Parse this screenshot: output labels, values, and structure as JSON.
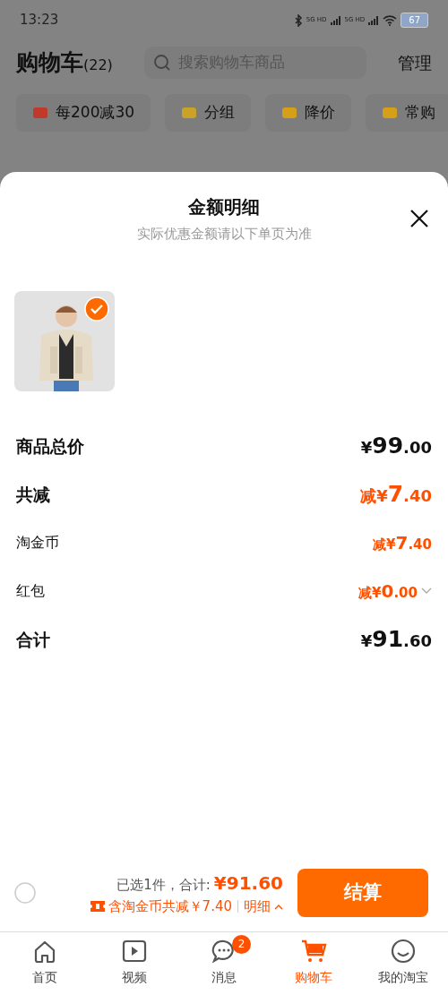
{
  "status_bar": {
    "time": "13:23",
    "network_1": "5G HD",
    "network_2": "5G HD",
    "battery": "67"
  },
  "header": {
    "title": "购物车",
    "count": "(22)",
    "search": {
      "placeholder": "搜索购物车商品"
    },
    "manage": "管理"
  },
  "chips": [
    {
      "label": "每200减30",
      "color": "#c0392b"
    },
    {
      "label": "分组",
      "color": "#c9a227"
    },
    {
      "label": "降价",
      "color": "#d4a017"
    },
    {
      "label": "常购",
      "color": "#d4a017"
    }
  ],
  "sheet": {
    "title": "金额明细",
    "subtitle": "实际优惠金额请以下单页为准",
    "item": {
      "kind": "picture",
      "selected": true
    },
    "rows": [
      {
        "kind": "main",
        "label": "商品总价",
        "prefix": "¥",
        "integer": "99",
        "decimal": ".00",
        "highlight": false,
        "expandable": false
      },
      {
        "kind": "main",
        "label": "共减",
        "prefix": "减¥",
        "integer": "7",
        "decimal": ".40",
        "highlight": true,
        "expandable": false
      },
      {
        "kind": "sub",
        "label": "淘金币",
        "prefix": "减¥",
        "integer": "7",
        "decimal": ".40",
        "highlight": true,
        "expandable": false
      },
      {
        "kind": "sub",
        "label": "红包",
        "prefix": "减¥",
        "integer": "0",
        "decimal": ".00",
        "highlight": true,
        "expandable": true
      },
      {
        "kind": "main",
        "label": "合计",
        "prefix": "¥",
        "integer": "91",
        "decimal": ".60",
        "highlight": false,
        "expandable": false
      }
    ]
  },
  "checkout": {
    "select_all": false,
    "selected_text": "已选1件，合计:",
    "total": "¥91.60",
    "discount_text": "含淘金币共减￥7.40",
    "detail_link": "明细",
    "button": "结算"
  },
  "tabbar": [
    {
      "label": "首页",
      "kind": "home",
      "selected": false
    },
    {
      "label": "视频",
      "kind": "video",
      "selected": false
    },
    {
      "label": "消息",
      "kind": "message",
      "selected": false,
      "badge": "2"
    },
    {
      "label": "购物车",
      "kind": "cart",
      "selected": true
    },
    {
      "label": "我的淘宝",
      "kind": "profile",
      "selected": false
    }
  ]
}
